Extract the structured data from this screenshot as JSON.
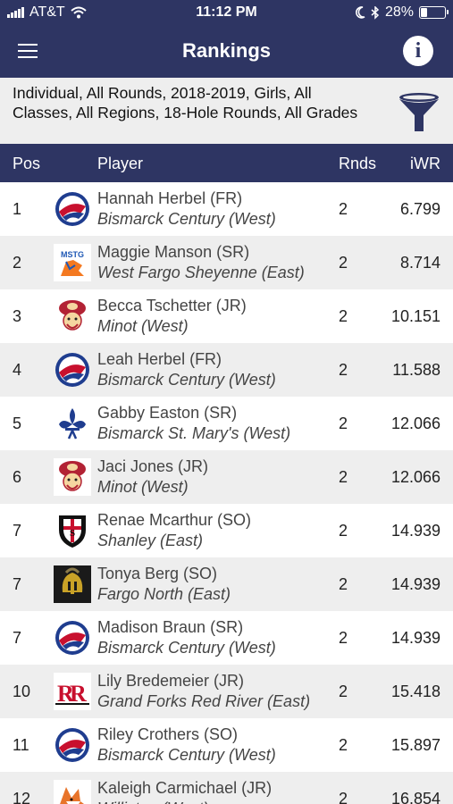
{
  "status_bar": {
    "carrier": "AT&T",
    "time": "11:12 PM",
    "battery": "28%",
    "battery_level": 0.28
  },
  "nav": {
    "title": "Rankings",
    "menu_icon": "hamburger-menu-icon",
    "info_icon": "info-icon",
    "info_glyph": "i"
  },
  "filter": {
    "text": "Individual, All Rounds, 2018-2019, Girls, All Classes, All Regions, 18-Hole Rounds, All Grades",
    "icon": "filter-funnel-icon"
  },
  "table": {
    "headers": {
      "pos": "Pos",
      "player": "Player",
      "rnds": "Rnds",
      "iwr": "iWR"
    },
    "rows": [
      {
        "pos": "1",
        "name": "Hannah Herbel (FR)",
        "school": "Bismarck Century (West)",
        "rnds": "2",
        "iwr": "6.799",
        "logo": "century-patriot-logo"
      },
      {
        "pos": "2",
        "name": "Maggie Manson (SR)",
        "school": "West Fargo Sheyenne (East)",
        "rnds": "2",
        "iwr": "8.714",
        "logo": "sheyenne-mustangs-logo"
      },
      {
        "pos": "3",
        "name": "Becca Tschetter (JR)",
        "school": "Minot (West)",
        "rnds": "2",
        "iwr": "10.151",
        "logo": "minot-magician-logo"
      },
      {
        "pos": "4",
        "name": "Leah Herbel (FR)",
        "school": "Bismarck Century (West)",
        "rnds": "2",
        "iwr": "11.588",
        "logo": "century-patriot-logo"
      },
      {
        "pos": "5",
        "name": "Gabby Easton (SR)",
        "school": "Bismarck St. Mary's (West)",
        "rnds": "2",
        "iwr": "12.066",
        "logo": "st-marys-fleur-de-lis-logo"
      },
      {
        "pos": "6",
        "name": "Jaci Jones (JR)",
        "school": "Minot (West)",
        "rnds": "2",
        "iwr": "12.066",
        "logo": "minot-magician-logo"
      },
      {
        "pos": "7",
        "name": "Renae Mcarthur (SO)",
        "school": "Shanley (East)",
        "rnds": "2",
        "iwr": "14.939",
        "logo": "shanley-shield-logo"
      },
      {
        "pos": "7",
        "name": "Tonya Berg (SO)",
        "school": "Fargo North (East)",
        "rnds": "2",
        "iwr": "14.939",
        "logo": "fargo-north-spartan-logo"
      },
      {
        "pos": "7",
        "name": "Madison Braun (SR)",
        "school": "Bismarck Century (West)",
        "rnds": "2",
        "iwr": "14.939",
        "logo": "century-patriot-logo"
      },
      {
        "pos": "10",
        "name": "Lily Bredemeier (JR)",
        "school": "Grand Forks Red River (East)",
        "rnds": "2",
        "iwr": "15.418",
        "logo": "red-river-rr-logo"
      },
      {
        "pos": "11",
        "name": "Riley Crothers (SO)",
        "school": "Bismarck Century (West)",
        "rnds": "2",
        "iwr": "15.897",
        "logo": "century-patriot-logo"
      },
      {
        "pos": "12",
        "name": "Kaleigh Carmichael (JR)",
        "school": "Williston (West)",
        "rnds": "2",
        "iwr": "16.854",
        "logo": "williston-coyote-logo"
      }
    ]
  },
  "colors": {
    "header_bg": "#2e3563",
    "row_alt_bg": "#eeeeee",
    "text": "#444444"
  }
}
